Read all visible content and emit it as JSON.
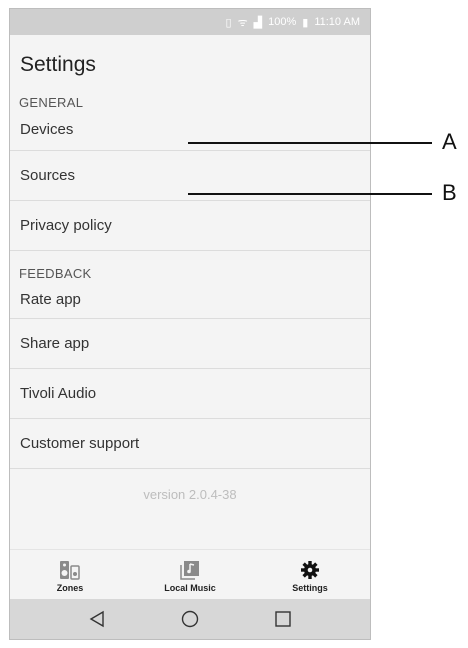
{
  "status_bar": {
    "battery_percent": "100%",
    "time": "11:10 AM"
  },
  "screen": {
    "title": "Settings"
  },
  "general": {
    "header": "GENERAL",
    "items": [
      "Devices",
      "Sources",
      "Privacy policy"
    ]
  },
  "feedback": {
    "header": "FEEDBACK",
    "items": [
      "Rate app",
      "Share app",
      "Tivoli Audio",
      "Customer support"
    ]
  },
  "version": "version 2.0.4-38",
  "tabs": [
    {
      "label": "Zones",
      "icon": "speaker-icon"
    },
    {
      "label": "Local Music",
      "icon": "music-library-icon"
    },
    {
      "label": "Settings",
      "icon": "gear-icon"
    }
  ],
  "callouts": [
    "A",
    "B"
  ],
  "colors": {
    "background": "#f4f4f4",
    "status_bar": "#cfcfcf",
    "nav_bar": "#d7d7d7",
    "divider": "#dcdcdc"
  }
}
